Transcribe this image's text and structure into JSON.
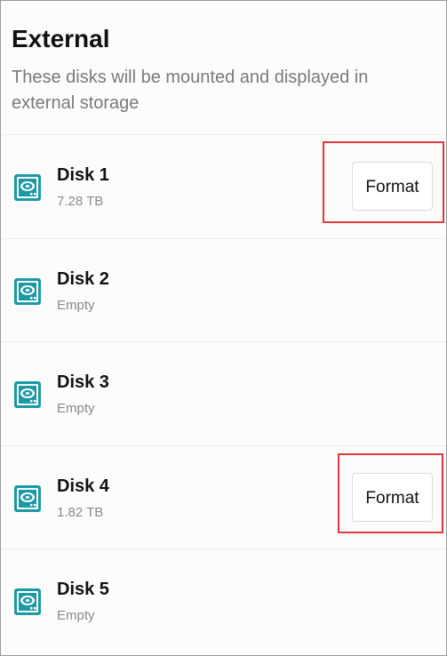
{
  "section": {
    "title": "External",
    "subtitle": "These disks will be mounted and displayed in external storage"
  },
  "colors": {
    "icon_accent": "#1a9aa5",
    "highlight": "#e0393c"
  },
  "disks": [
    {
      "name": "Disk 1",
      "detail": "7.28 TB",
      "action_label": "Format",
      "icon": "hard-disk-icon"
    },
    {
      "name": "Disk 2",
      "detail": "Empty",
      "icon": "hard-disk-icon"
    },
    {
      "name": "Disk 3",
      "detail": "Empty",
      "icon": "hard-disk-icon"
    },
    {
      "name": "Disk 4",
      "detail": "1.82 TB",
      "action_label": "Format",
      "icon": "hard-disk-icon"
    },
    {
      "name": "Disk 5",
      "detail": "Empty",
      "icon": "hard-disk-icon"
    }
  ]
}
